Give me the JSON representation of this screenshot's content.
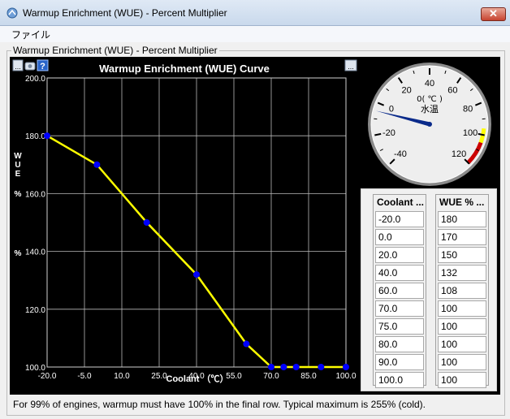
{
  "window": {
    "title": "Warmup Enrichment (WUE) - Percent Multiplier",
    "close_label": "✕"
  },
  "menu": {
    "file": "ファイル"
  },
  "group_title": "Warmup Enrichment (WUE) - Percent Multiplier",
  "chart": {
    "title": "Warmup Enrichment (WUE) Curve",
    "toolbar_left": "...",
    "toolbar_right": "...",
    "help_glyph": "?",
    "ylabel_lines": [
      "W",
      "U",
      "E",
      "%",
      "%"
    ],
    "xlabel": "Coolant （℃）",
    "line_color": "#ffff00",
    "point_color": "#0000ff"
  },
  "chart_data": {
    "type": "line",
    "title": "Warmup Enrichment (WUE) Curve",
    "xlabel": "Coolant （℃）",
    "ylabel": "WUE %",
    "x": [
      -20.0,
      0.0,
      20.0,
      40.0,
      60.0,
      70.0,
      75.0,
      80.0,
      90.0,
      100.0
    ],
    "y": [
      180,
      170,
      150,
      132,
      108,
      100,
      100,
      100,
      100,
      100
    ],
    "xlim": [
      -20.0,
      100.0
    ],
    "ylim": [
      100.0,
      200.0
    ],
    "x_ticks": [
      "-20.0",
      "-5.0",
      "10.0",
      "25.0",
      "40.0",
      "55.0",
      "70.0",
      "85.0",
      "100.0"
    ],
    "y_ticks": [
      "100.0",
      "120.0",
      "140.0",
      "160.0",
      "180.0",
      "200.0"
    ],
    "grid": true
  },
  "gauge": {
    "center_label": "0( ℃ )",
    "title": "水温",
    "value": -5,
    "min": -40,
    "max": 120,
    "ticks": [
      "-40",
      "-20",
      "0",
      "20",
      "40",
      "60",
      "80",
      "100",
      "120"
    ],
    "warn_color": "#ffff00",
    "danger_color": "#cc0000"
  },
  "table": {
    "col1_header": "Coolant ...",
    "col2_header": "WUE % ...",
    "coolant": [
      "-20.0",
      "0.0",
      "20.0",
      "40.0",
      "60.0",
      "70.0",
      "75.0",
      "80.0",
      "90.0",
      "100.0"
    ],
    "wue": [
      "180",
      "170",
      "150",
      "132",
      "108",
      "100",
      "100",
      "100",
      "100",
      "100"
    ]
  },
  "status": "For 99% of engines, warmup must have 100% in the final row. Typical maximum is 255% (cold)."
}
